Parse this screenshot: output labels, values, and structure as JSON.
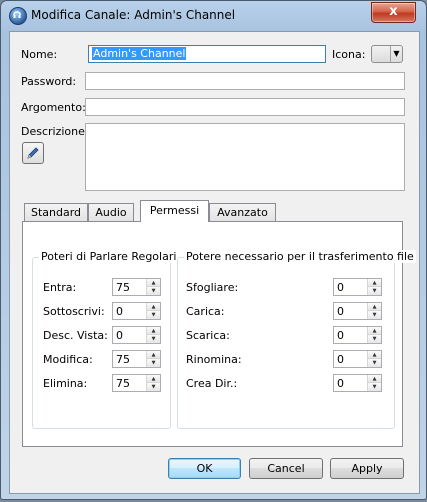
{
  "window": {
    "title": "Modifica Canale: Admin's Channel",
    "close_label": "x"
  },
  "form": {
    "name_label": "Nome:",
    "name_value": "Admin's Channel",
    "icon_label": "Icona:",
    "password_label": "Password:",
    "password_value": "",
    "topic_label": "Argomento:",
    "topic_value": "",
    "description_label": "Descrizione:",
    "description_value": ""
  },
  "tabs": [
    "Standard",
    "Audio",
    "Permessi",
    "Avanzato"
  ],
  "active_tab": "Permessi",
  "talk_powers": {
    "title": "Poteri di Parlare Regolari",
    "rows": [
      {
        "label": "Entra:",
        "value": "75"
      },
      {
        "label": "Sottoscrivi:",
        "value": "0"
      },
      {
        "label": "Desc. Vista:",
        "value": "0"
      },
      {
        "label": "Modifica:",
        "value": "75"
      },
      {
        "label": "Elimina:",
        "value": "75"
      }
    ]
  },
  "transfer_powers": {
    "title": "Potere necessario per il trasferimento file",
    "rows": [
      {
        "label": "Sfogliare:",
        "value": "0"
      },
      {
        "label": "Carica:",
        "value": "0"
      },
      {
        "label": "Scarica:",
        "value": "0"
      },
      {
        "label": "Rinomina:",
        "value": "0"
      },
      {
        "label": "Crea Dir.:",
        "value": "0"
      }
    ]
  },
  "buttons": {
    "ok": "OK",
    "cancel": "Cancel",
    "apply": "Apply"
  }
}
